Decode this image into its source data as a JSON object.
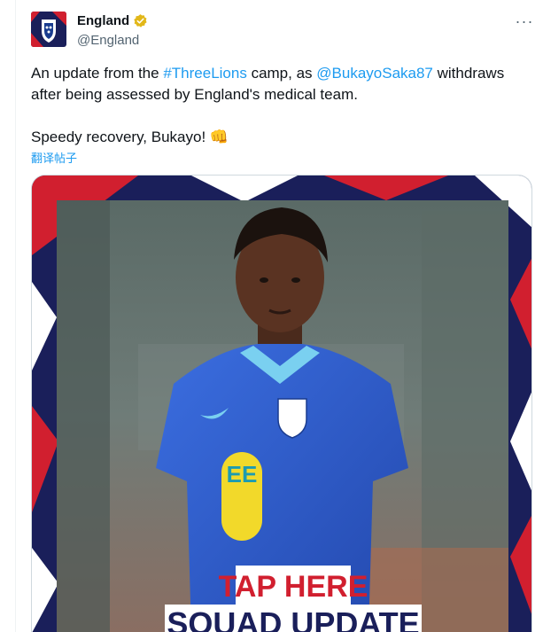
{
  "account": {
    "display_name": "England",
    "handle": "@England",
    "verified_color": "#e2b719"
  },
  "menu": {
    "more_label": "···"
  },
  "tweet": {
    "line1_prefix": "An update from the ",
    "hashtag": "#ThreeLions",
    "line1_middle": " camp, as ",
    "mention": "@BukayoSaka87",
    "line1_suffix": " withdraws after being assessed by England's medical team.",
    "line2": "Speedy recovery, Bukayo! 👊"
  },
  "translate": {
    "label": "翻译帖子"
  },
  "media": {
    "cta_top": "TAP HERE",
    "cta_bottom": "SQUAD UPDATE",
    "sponsor": "EE",
    "colors": {
      "navy": "#1a1f5a",
      "red": "#d11f2f",
      "kit_blue": "#2f5fcf",
      "sponsor_yellow": "#f2d92a"
    }
  }
}
